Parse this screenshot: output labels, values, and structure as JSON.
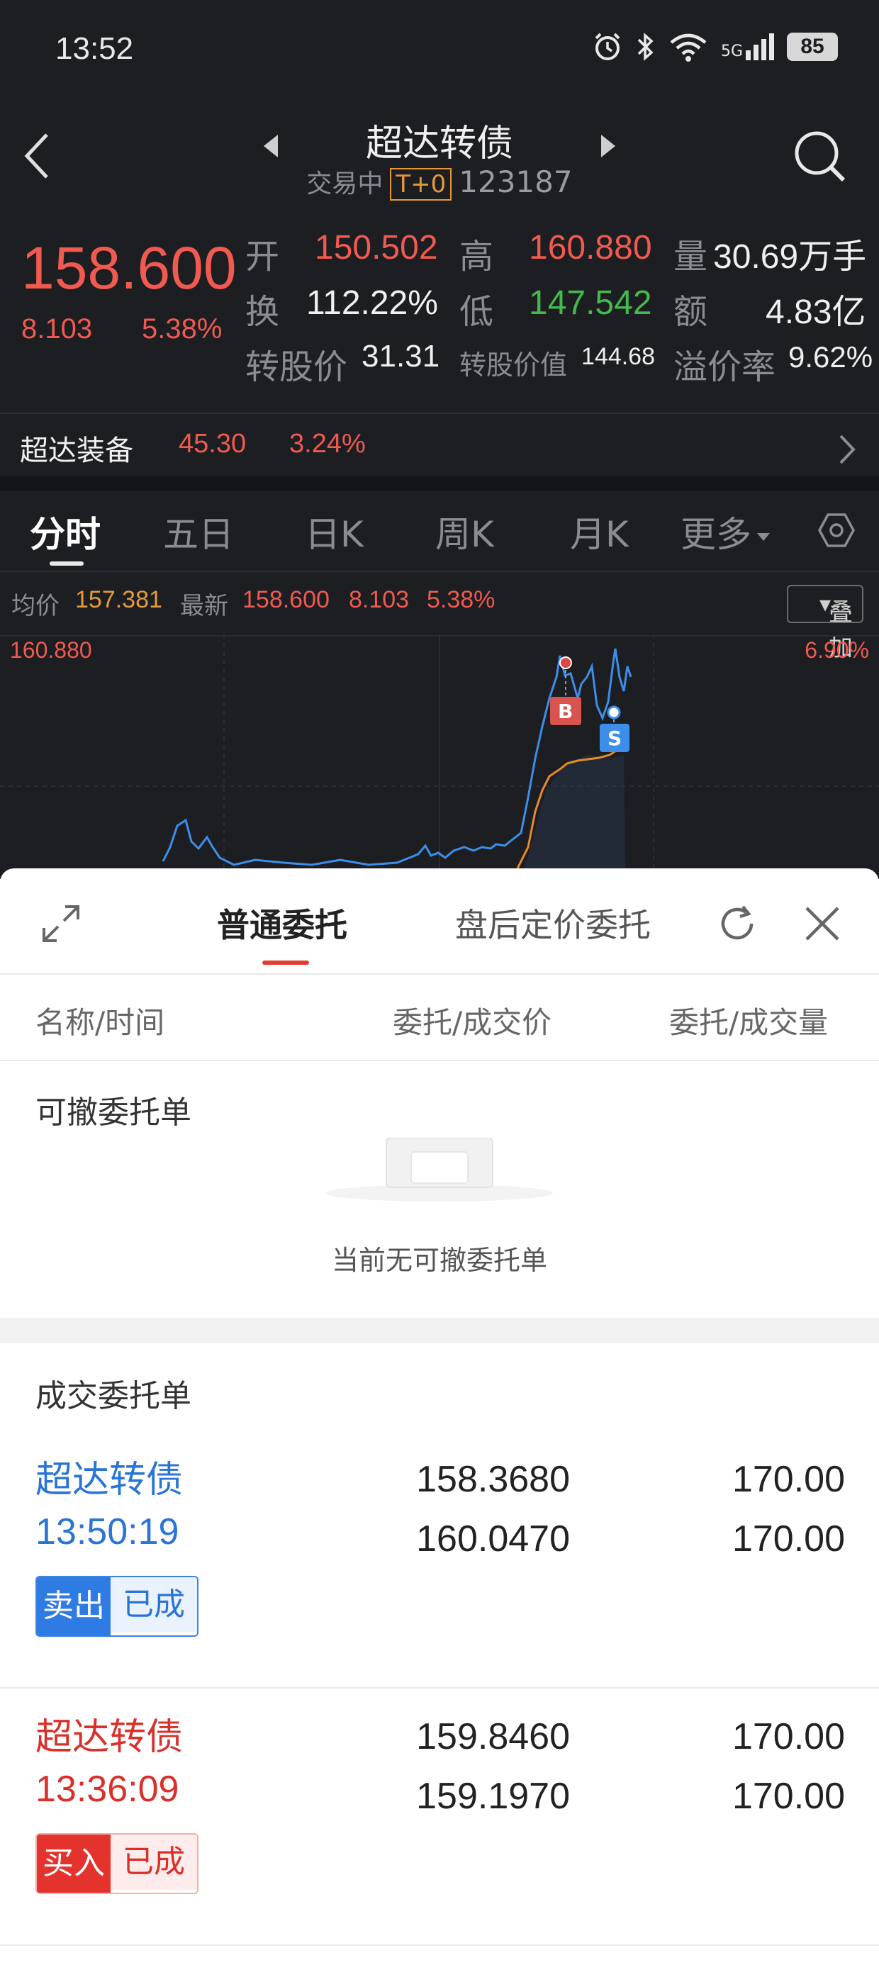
{
  "status_bar": {
    "time": "13:52",
    "battery": "85",
    "network": "5G"
  },
  "header": {
    "title": "超达转债",
    "trading_status": "交易中",
    "tag": "T+0",
    "code": "123187"
  },
  "quote": {
    "price": "158.600",
    "change": "8.103",
    "change_pct": "5.38%",
    "open_label": "开",
    "open": "150.502",
    "high_label": "高",
    "high": "160.880",
    "volume_label": "量",
    "volume": "30.69万手",
    "turnover_label": "换",
    "turnover": "112.22%",
    "low_label": "低",
    "low": "147.542",
    "amount_label": "额",
    "amount": "4.83亿",
    "conv_price_label": "转股价",
    "conv_price": "31.31",
    "conv_value_label": "转股价值",
    "conv_value": "144.68",
    "premium_label": "溢价率",
    "premium": "9.62%"
  },
  "related_stock": {
    "name": "超达装备",
    "price": "45.30",
    "change_pct": "3.24%"
  },
  "chart_tabs": {
    "items": [
      "分时",
      "五日",
      "日K",
      "周K",
      "月K"
    ],
    "more": "更多"
  },
  "chart_info": {
    "avg_label": "均价",
    "avg": "157.381",
    "latest_label": "最新",
    "latest": "158.600",
    "change": "8.103",
    "change_pct": "5.38%",
    "overlay": "叠加",
    "top_price": "160.880",
    "top_pct": "6.90%",
    "buy_marker": "B",
    "sell_marker": "S"
  },
  "sheet": {
    "tab_normal": "普通委托",
    "tab_after_hours": "盘后定价委托",
    "col_name": "名称/时间",
    "col_price": "委托/成交价",
    "col_qty": "委托/成交量",
    "cancelable_title": "可撤委托单",
    "empty_text": "当前无可撤委托单",
    "filled_title": "成交委托单",
    "orders": [
      {
        "name": "超达转债",
        "time": "13:50:19",
        "order_price": "158.3680",
        "fill_price": "160.0470",
        "order_qty": "170.00",
        "fill_qty": "170.00",
        "side": "卖出",
        "state": "已成"
      },
      {
        "name": "超达转债",
        "time": "13:36:09",
        "order_price": "159.8460",
        "fill_price": "159.1970",
        "order_qty": "170.00",
        "fill_qty": "170.00",
        "side": "买入",
        "state": "已成"
      }
    ]
  },
  "colors": {
    "up": "#f05a50",
    "down": "#43b94e",
    "sell": "#2e7be4",
    "buy": "#e4322c",
    "accent": "#e23b30"
  }
}
